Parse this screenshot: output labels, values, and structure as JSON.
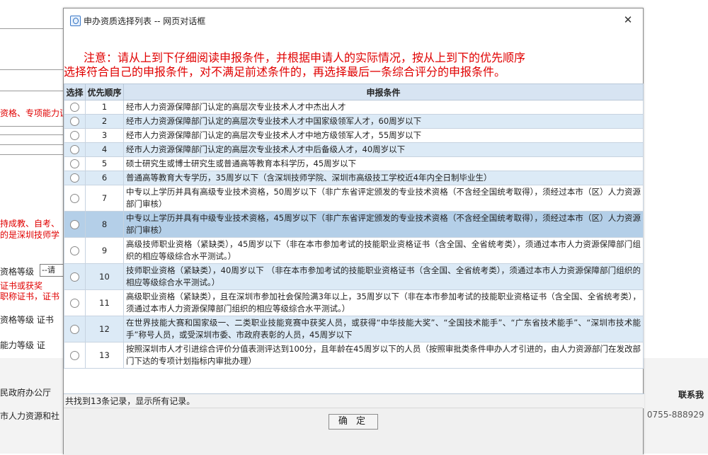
{
  "background": {
    "left_texts": [
      {
        "name": "bg-text-qualification",
        "text": "资格、专项能力证",
        "red": true
      },
      {
        "name": "bg-text-holder",
        "text": "持成教、自考、",
        "red": true
      },
      {
        "name": "bg-text-school",
        "text": "的是深圳技师学",
        "red": true
      },
      {
        "name": "bg-text-level",
        "text": "资格等级",
        "red": false
      },
      {
        "name": "bg-text-cert-award",
        "text": "证书或获奖",
        "red": true
      },
      {
        "name": "bg-text-title-cert",
        "text": "职称证书，证书",
        "red": true
      },
      {
        "name": "bg-text-level-cert",
        "text": "资格等级  证书",
        "red": false
      },
      {
        "name": "bg-text-ability-level",
        "text": "能力等级      证",
        "red": false
      }
    ],
    "select_value": "--请",
    "footer_left_1": "民政府办公厅",
    "footer_left_2": "市人力资源和社",
    "footer_right_1": "联系我",
    "footer_right_2": ": 0755-888929"
  },
  "dialog": {
    "title": "申办资质选择列表 -- 网页对话框",
    "close_glyph": "✕",
    "notice_line1": "注意：请从上到下仔细阅读申报条件，并根据申请人的实际情况，按从上到下的优先顺序",
    "notice_line2": "选择符合自己的申报条件，对不满足前述条件的，再选择最后一条综合评分的申报条件。",
    "headers": {
      "select": "选择",
      "priority": "优先顺序",
      "condition": "申报条件"
    },
    "rows": [
      {
        "priority": "1",
        "condition": "经市人力资源保障部门认定的高层次专业技术人才中杰出人才"
      },
      {
        "priority": "2",
        "condition": "经市人力资源保障部门认定的高层次专业技术人才中国家级领军人才，60周岁以下"
      },
      {
        "priority": "3",
        "condition": "经市人力资源保障部门认定的高层次专业技术人才中地方级领军人才，55周岁以下"
      },
      {
        "priority": "4",
        "condition": "经市人力资源保障部门认定的高层次专业技术人才中后备级人才，40周岁以下"
      },
      {
        "priority": "5",
        "condition": "硕士研究生或博士研究生或普通高等教育本科学历，45周岁以下"
      },
      {
        "priority": "6",
        "condition": "普通高等教育大专学历，35周岁以下（含深圳技师学院、深圳市高级技工学校近4年内全日制毕业生）"
      },
      {
        "priority": "7",
        "condition": "中专以上学历并具有高级专业技术资格，50周岁以下（非广东省评定颁发的专业技术资格（不含经全国统考取得），须经过本市（区）人力资源部门审核）"
      },
      {
        "priority": "8",
        "condition": "中专以上学历并具有中级专业技术资格，45周岁以下（非广东省评定颁发的专业技术资格（不含经全国统考取得），须经过本市（区）人力资源部门审核）"
      },
      {
        "priority": "9",
        "condition": "高级技师职业资格（紧缺类），45周岁以下（非在本市参加考试的技能职业资格证书（含全国、全省统考类），须通过本市人力资源保障部门组织的相应等级综合水平测试。）"
      },
      {
        "priority": "10",
        "condition": "技师职业资格（紧缺类），40周岁以下 （非在本市参加考试的技能职业资格证书（含全国、全省统考类），须通过本市人力资源保障部门组织的相应等级综合水平测试。）"
      },
      {
        "priority": "11",
        "condition": "高级职业资格（紧缺类），且在深圳市参加社会保险满3年以上，35周岁以下（非在本市参加考试的技能职业资格证书（含全国、全省统考类），须通过本市人力资源保障部门组织的相应等级综合水平测试。）"
      },
      {
        "priority": "12",
        "condition": "在世界技能大赛和国家级一、二类职业技能竞赛中获奖人员，或获得“中华技能大奖”、“全国技术能手”、“广东省技术能手”、“深圳市技术能手”称号人员，或受深圳市委、市政府表彰的人员，45周岁以下"
      },
      {
        "priority": "13",
        "condition": "按照深圳市人才引进综合评价分值表测评达到100分，且年龄在45周岁以下的人员（按照审批类条件申办人才引进的，由人力资源部门在发改部门下达的专项计划指标内审批办理）"
      }
    ],
    "status": "共找到13条记录，显示所有记录。",
    "confirm_label": "确 定"
  },
  "colors": {
    "notice_red": "#e00000",
    "header_bg": "#d7e4f2",
    "row_alt_bg": "#dceaf6",
    "row_highlight_bg": "#b4cfe8"
  }
}
